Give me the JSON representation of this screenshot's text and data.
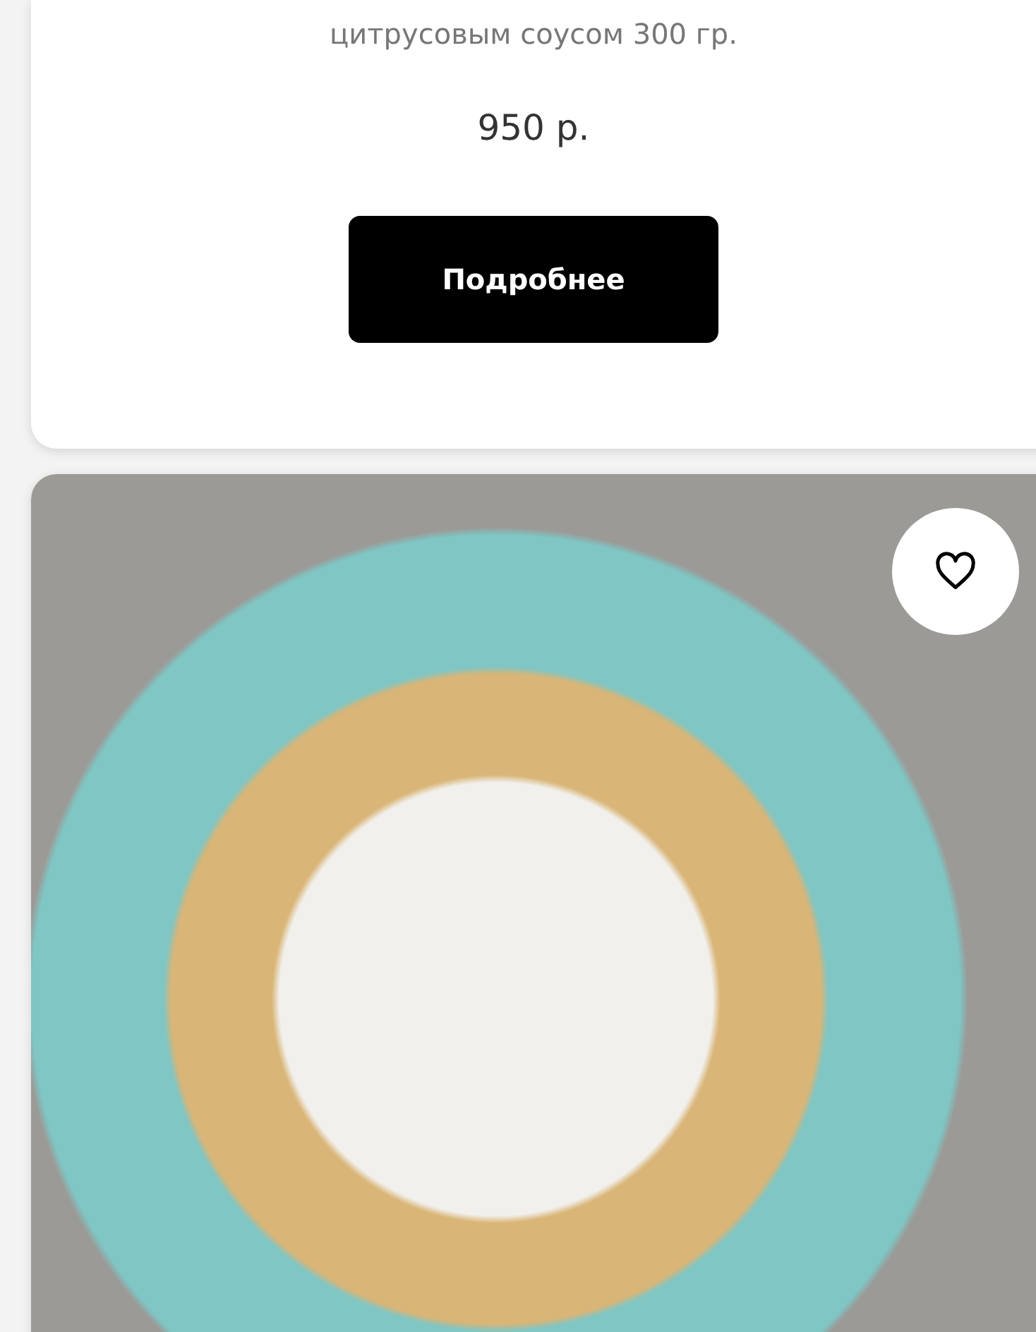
{
  "cards": [
    {
      "description": "цитрусовым соусом 300 гр.",
      "price": "950 р.",
      "button": "Подробнее"
    },
    {
      "favorite": false
    }
  ]
}
